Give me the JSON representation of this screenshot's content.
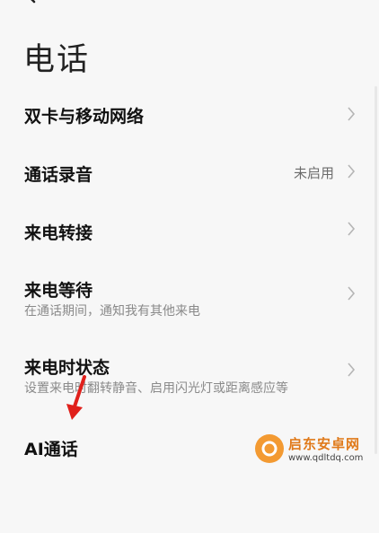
{
  "header": {
    "title": "电话"
  },
  "settings": [
    {
      "label": "双卡与移动网络",
      "value": "",
      "subtitle": ""
    },
    {
      "label": "通话录音",
      "value": "未启用",
      "subtitle": ""
    },
    {
      "label": "来电转接",
      "value": "",
      "subtitle": ""
    },
    {
      "label": "来电等待",
      "value": "",
      "subtitle": "在通话期间，通知我有其他来电"
    },
    {
      "label": "来电时状态",
      "value": "",
      "subtitle": "设置来电时翻转静音、启用闪光灯或距离感应等"
    },
    {
      "label": "AI通话",
      "value": "",
      "subtitle": ""
    }
  ],
  "watermark": {
    "name": "启东安卓网",
    "url": "www.qdltdq.com"
  },
  "icons": {
    "back": "back-arrow-icon",
    "chevron": "chevron-right-icon",
    "pointer": "red-arrow-annotation-icon"
  },
  "colors": {
    "background": "#f7f7f7",
    "annotation": "#e0201b",
    "watermark": "#e07a1a"
  }
}
